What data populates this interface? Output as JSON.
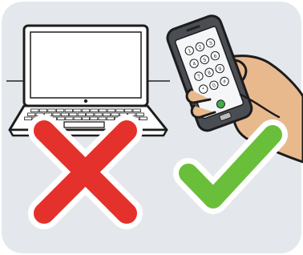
{
  "illustration": {
    "background_color": "#e4e8ec",
    "left_item": {
      "device": "laptop-icon",
      "verdict": "cross-icon",
      "verdict_color": "#e5312b"
    },
    "right_item": {
      "device": "smartphone-in-hand-icon",
      "screen": "phone-dialpad-icon",
      "verdict": "checkmark-icon",
      "verdict_color": "#6abf3a"
    },
    "phone_dial_keys": [
      "1",
      "2",
      "3",
      "4",
      "5",
      "6",
      "7",
      "8",
      "9",
      "*",
      "0",
      "#"
    ]
  }
}
